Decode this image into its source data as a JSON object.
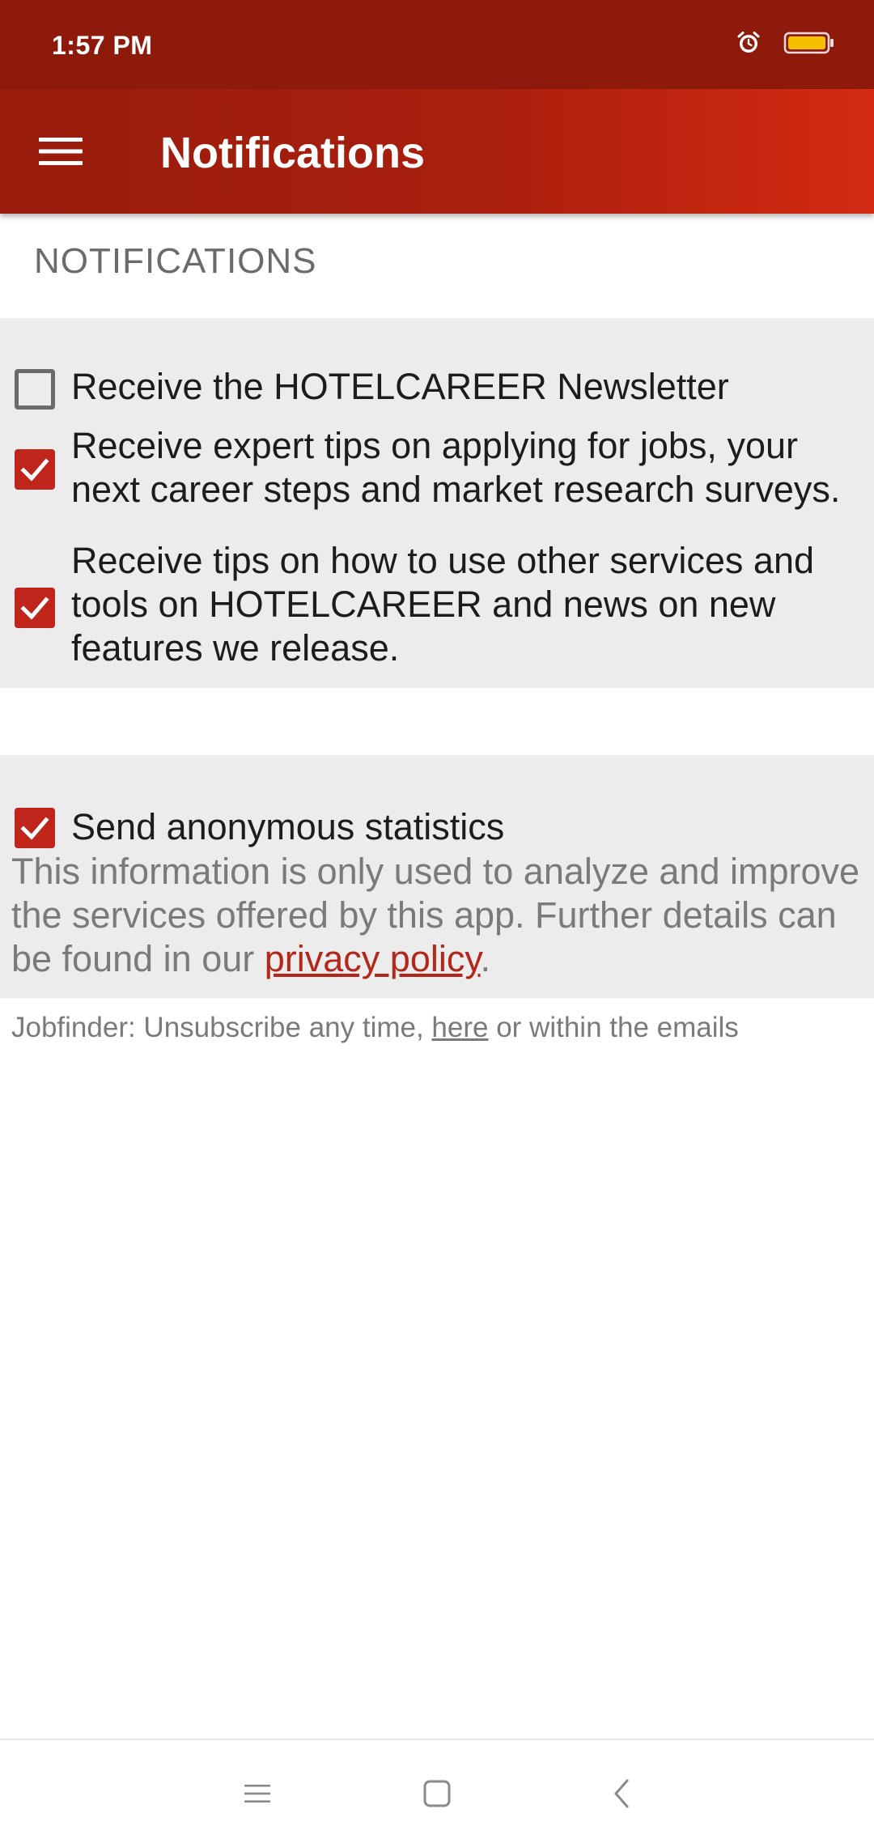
{
  "status_bar": {
    "time": "1:57 PM",
    "icons": [
      "alarm-icon",
      "battery-icon"
    ],
    "battery_color": "#f5c000"
  },
  "app_bar": {
    "title": "Notifications",
    "menu_icon": "hamburger-menu-icon"
  },
  "section": {
    "title": "NOTIFICATIONS"
  },
  "notification_options": [
    {
      "label": "Receive the HOTELCAREER Newsletter",
      "checked": false
    },
    {
      "label": "Receive expert tips on applying for jobs, your next career steps and market research surveys.",
      "checked": true
    },
    {
      "label": "Receive tips on how to use other services and tools on HOTELCAREER and news on new features we release.",
      "checked": true
    }
  ],
  "statistics": {
    "label": "Send anonymous statistics",
    "checked": true,
    "info_line1": "This information is only used to analyze and improve",
    "info_line2": "the services offered by this app. Further details can",
    "info_line3_prefix": "be found in our ",
    "privacy_link": "privacy policy",
    "info_line3_suffix": "."
  },
  "footer": {
    "prefix": "Jobfinder: Unsubscribe any time, ",
    "link": "here",
    "suffix": " or within the emails"
  },
  "nav_bar": {
    "buttons": [
      "recents-icon",
      "home-icon",
      "back-icon"
    ]
  },
  "colors": {
    "status_bar": "#8e1a0b",
    "app_bar_start": "#991c0c",
    "app_bar_end": "#d42a12",
    "accent": "#c0251b",
    "group_background": "#ececec"
  }
}
